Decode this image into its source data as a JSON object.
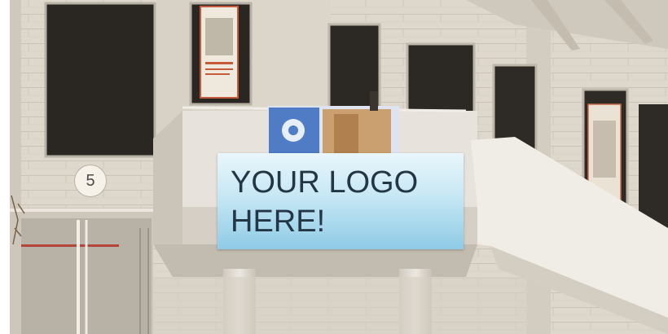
{
  "sign": {
    "text": "YOUR LOGO\nHERE!"
  },
  "floor_number": "5",
  "colors": {
    "wall": "#e2dcd2",
    "concrete": "#d9d3c8",
    "window": "#2a2622",
    "sign_top": "#e9f6fb",
    "sign_bottom": "#8fcbe6",
    "sign_text": "#233645"
  }
}
